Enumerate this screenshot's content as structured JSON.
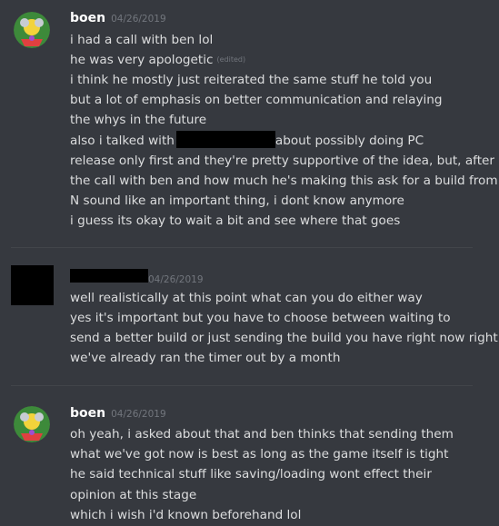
{
  "groups": [
    {
      "author": "boen",
      "timestamp": "04/26/2019",
      "lines": [
        "i had a call with ben lol",
        "he was very apologetic",
        "i think he mostly just reiterated the same stuff he told you",
        "but a lot of emphasis on better communication and relaying",
        "the whys in the future",
        "also i talked with",
        "about possibly doing PC",
        "release only first and they're pretty supportive of the idea, but, after",
        "the call with ben and how much he's making this ask for a build from",
        "N sound like an important thing, i dont know anymore",
        "i guess its okay to wait a bit and see where that goes"
      ],
      "edited_label": "(edited)"
    },
    {
      "author": "",
      "timestamp": "04/26/2019",
      "lines": [
        "well realistically at this point what can you do either way",
        "yes it's important but you have to choose between waiting to",
        "send a better build or just sending the build you have right now right",
        "we've already ran the timer out by a month"
      ]
    },
    {
      "author": "boen",
      "timestamp": "04/26/2019",
      "lines": [
        "oh yeah, i asked about that and ben thinks that sending them",
        "what we've got now is best as long as the game itself is tight",
        "he said technical stuff like saving/loading wont effect their",
        "opinion at this stage",
        "which i wish i'd known beforehand lol"
      ]
    }
  ],
  "colors": {
    "background": "#36393f",
    "username": "#ffffff",
    "message_text": "#dcddde",
    "timestamp": "#72767d",
    "redaction": "#000000"
  }
}
